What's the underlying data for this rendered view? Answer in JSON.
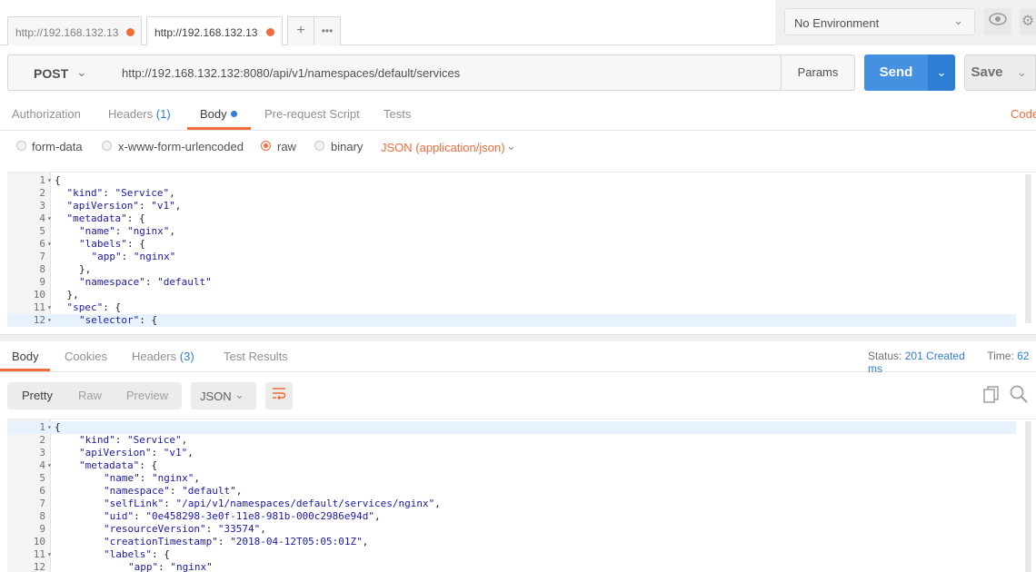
{
  "tabs": [
    {
      "label": "http://192.168.132.13"
    },
    {
      "label": "http://192.168.132.13"
    }
  ],
  "tab_actions": {
    "new": "+",
    "more": "•••"
  },
  "environment": {
    "selected": "No Environment"
  },
  "request": {
    "method": "POST",
    "url": "http://192.168.132.132:8080/api/v1/namespaces/default/services",
    "params_label": "Params",
    "send_label": "Send",
    "save_label": "Save"
  },
  "request_tabs": {
    "authorization": "Authorization",
    "headers": "Headers",
    "headers_count": "(1)",
    "body": "Body",
    "pre_request": "Pre-request Script",
    "tests": "Tests",
    "code": "Code"
  },
  "body_types": {
    "form_data": "form-data",
    "urlencoded": "x-www-form-urlencoded",
    "raw": "raw",
    "binary": "binary",
    "content_type": "JSON (application/json)"
  },
  "request_body": [
    {
      "n": "1",
      "fold": true,
      "indent": 0,
      "text": "{"
    },
    {
      "n": "2",
      "fold": false,
      "indent": 1,
      "text": "\"kind\": \"Service\","
    },
    {
      "n": "3",
      "fold": false,
      "indent": 1,
      "text": "\"apiVersion\": \"v1\","
    },
    {
      "n": "4",
      "fold": true,
      "indent": 1,
      "text": "\"metadata\": {"
    },
    {
      "n": "5",
      "fold": false,
      "indent": 2,
      "text": "\"name\": \"nginx\","
    },
    {
      "n": "6",
      "fold": true,
      "indent": 2,
      "text": "\"labels\": {"
    },
    {
      "n": "7",
      "fold": false,
      "indent": 3,
      "text": "\"app\": \"nginx\""
    },
    {
      "n": "8",
      "fold": false,
      "indent": 2,
      "text": "},"
    },
    {
      "n": "9",
      "fold": false,
      "indent": 2,
      "text": "\"namespace\": \"default\""
    },
    {
      "n": "10",
      "fold": false,
      "indent": 1,
      "text": "},"
    },
    {
      "n": "11",
      "fold": true,
      "indent": 1,
      "text": "\"spec\": {"
    },
    {
      "n": "12",
      "fold": true,
      "indent": 2,
      "text": "\"selector\": {"
    }
  ],
  "response_tabs": {
    "body": "Body",
    "cookies": "Cookies",
    "headers": "Headers",
    "headers_count": "(3)",
    "test_results": "Test Results"
  },
  "response_status": {
    "status_label": "Status:",
    "status_value": "201 Created",
    "time_label": "Time:",
    "time_value": "62 ms"
  },
  "view_modes": {
    "pretty": "Pretty",
    "raw": "Raw",
    "preview": "Preview",
    "format": "JSON"
  },
  "response_body": [
    {
      "n": "1",
      "fold": true,
      "indent": 0,
      "text": "{"
    },
    {
      "n": "2",
      "fold": false,
      "indent": 1,
      "text": "\"kind\": \"Service\","
    },
    {
      "n": "3",
      "fold": false,
      "indent": 1,
      "text": "\"apiVersion\": \"v1\","
    },
    {
      "n": "4",
      "fold": true,
      "indent": 1,
      "text": "\"metadata\": {"
    },
    {
      "n": "5",
      "fold": false,
      "indent": 2,
      "text": "\"name\": \"nginx\","
    },
    {
      "n": "6",
      "fold": false,
      "indent": 2,
      "text": "\"namespace\": \"default\","
    },
    {
      "n": "7",
      "fold": false,
      "indent": 2,
      "text": "\"selfLink\": \"/api/v1/namespaces/default/services/nginx\","
    },
    {
      "n": "8",
      "fold": false,
      "indent": 2,
      "text": "\"uid\": \"0e458298-3e0f-11e8-981b-000c2986e94d\","
    },
    {
      "n": "9",
      "fold": false,
      "indent": 2,
      "text": "\"resourceVersion\": \"33574\","
    },
    {
      "n": "10",
      "fold": false,
      "indent": 2,
      "text": "\"creationTimestamp\": \"2018-04-12T05:05:01Z\","
    },
    {
      "n": "11",
      "fold": true,
      "indent": 2,
      "text": "\"labels\": {"
    },
    {
      "n": "12",
      "fold": false,
      "indent": 3,
      "text": "\"app\": \"nginx\""
    }
  ],
  "colors": {
    "accent": "#f26b3a",
    "send": "#4591e1",
    "link": "#2f7ed6"
  }
}
